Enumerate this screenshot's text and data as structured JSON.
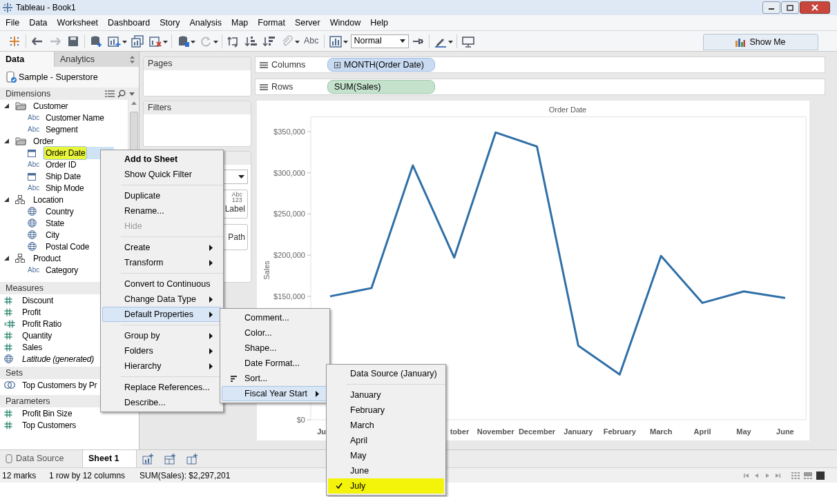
{
  "window": {
    "title": "Tableau - Book1"
  },
  "menu_bar": [
    "File",
    "Data",
    "Worksheet",
    "Dashboard",
    "Story",
    "Analysis",
    "Map",
    "Format",
    "Server",
    "Window",
    "Help"
  ],
  "toolbar": {
    "text_button": "Abc",
    "fit_select": "Normal",
    "show_me": "Show Me"
  },
  "data_pane": {
    "tabs": [
      {
        "label": "Data",
        "selected": true
      },
      {
        "label": "Analytics",
        "selected": false
      }
    ],
    "data_source": "Sample - Superstore",
    "dimensions": {
      "header": "Dimensions",
      "items": [
        {
          "kind": "folder",
          "label": "Customer",
          "expanded": true,
          "selected": false,
          "highlighted": false,
          "children": [
            {
              "kind": "string",
              "type_label": "Abc",
              "label": "Customer Name",
              "selected": false,
              "highlighted": false
            },
            {
              "kind": "string",
              "type_label": "Abc",
              "label": "Segment",
              "selected": false,
              "highlighted": false
            }
          ]
        },
        {
          "kind": "folder",
          "label": "Order",
          "expanded": true,
          "selected": false,
          "highlighted": false,
          "children": [
            {
              "kind": "date",
              "label": "Order Date",
              "selected": true,
              "highlighted": true
            },
            {
              "kind": "string",
              "type_label": "Abc",
              "label": "Order ID",
              "selected": false,
              "highlighted": false
            },
            {
              "kind": "date",
              "label": "Ship Date",
              "selected": false,
              "highlighted": false
            },
            {
              "kind": "string",
              "type_label": "Abc",
              "label": "Ship Mode",
              "selected": false,
              "highlighted": false
            }
          ]
        },
        {
          "kind": "hierarchy",
          "label": "Location",
          "expanded": true,
          "selected": false,
          "highlighted": false,
          "children": [
            {
              "kind": "geo",
              "label": "Country",
              "selected": false,
              "highlighted": false
            },
            {
              "kind": "geo",
              "label": "State",
              "selected": false,
              "highlighted": false
            },
            {
              "kind": "geo",
              "label": "City",
              "selected": false,
              "highlighted": false
            },
            {
              "kind": "geo",
              "label": "Postal Code",
              "selected": false,
              "highlighted": false
            }
          ]
        },
        {
          "kind": "hierarchy",
          "label": "Product",
          "expanded": true,
          "selected": false,
          "highlighted": false,
          "children": [
            {
              "kind": "string",
              "type_label": "Abc",
              "label": "Category",
              "selected": false,
              "highlighted": false
            }
          ]
        }
      ]
    },
    "measures": {
      "header": "Measures",
      "items": [
        {
          "kind": "number",
          "label": "Discount",
          "italic": false
        },
        {
          "kind": "number",
          "label": "Profit",
          "italic": false
        },
        {
          "kind": "calc_number",
          "label": "Profit Ratio",
          "italic": false
        },
        {
          "kind": "number",
          "label": "Quantity",
          "italic": false
        },
        {
          "kind": "number",
          "label": "Sales",
          "italic": false
        },
        {
          "kind": "geo",
          "label": "Latitude (generated)",
          "italic": true
        }
      ]
    },
    "sets": {
      "header": "Sets",
      "items": [
        {
          "kind": "set",
          "label": "Top Customers by Pr",
          "italic": false
        }
      ]
    },
    "parameters": {
      "header": "Parameters",
      "items": [
        {
          "kind": "number",
          "label": "Profit Bin Size",
          "italic": false
        },
        {
          "kind": "number",
          "label": "Top Customers",
          "italic": false
        }
      ]
    }
  },
  "cards": {
    "pages": "Pages",
    "filters": "Filters",
    "marks": {
      "buttons": [
        {
          "kind": "label",
          "icon_lines": [
            "Abc",
            "123"
          ],
          "label": "Label"
        },
        {
          "kind": "path",
          "label": "Path"
        }
      ]
    }
  },
  "shelves": [
    {
      "label": "Columns",
      "pill": {
        "text": "MONTH(Order Date)",
        "kind": "discrete"
      }
    },
    {
      "label": "Rows",
      "pill": {
        "text": "SUM(Sales)",
        "kind": "continuous"
      }
    }
  ],
  "chart_data": {
    "type": "line",
    "title": "Order Date",
    "ylabel": "Sales",
    "categories": [
      "Ju",
      null,
      null,
      "tober",
      "November",
      "December",
      "January",
      "February",
      "March",
      "April",
      "May",
      "June"
    ],
    "series": [
      {
        "color": "#2f6fa7",
        "values": [
          150000,
          160000,
          309000,
          197000,
          349000,
          332000,
          90000,
          55000,
          199000,
          142000,
          156000,
          148000
        ]
      }
    ],
    "ylim": [
      0,
      368000
    ],
    "yticks": [
      {
        "value": 0,
        "label": "$0"
      },
      {
        "value": 150000,
        "label": "$150,000"
      },
      {
        "value": 200000,
        "label": "$200,000"
      },
      {
        "value": 250000,
        "label": "$250,000"
      },
      {
        "value": 300000,
        "label": "$300,000"
      },
      {
        "value": 350000,
        "label": "$350,000"
      }
    ]
  },
  "context_menu": [
    [
      {
        "label": "Add to Sheet",
        "default": true,
        "disabled": false,
        "submenu": false,
        "selected": false
      },
      {
        "label": "Show Quick Filter",
        "default": false,
        "disabled": false,
        "submenu": false,
        "selected": false
      }
    ],
    [
      {
        "label": "Duplicate",
        "default": false,
        "disabled": false,
        "submenu": false,
        "selected": false
      },
      {
        "label": "Rename...",
        "default": false,
        "disabled": false,
        "submenu": false,
        "selected": false
      },
      {
        "label": "Hide",
        "default": false,
        "disabled": true,
        "submenu": false,
        "selected": false
      }
    ],
    [
      {
        "label": "Create",
        "default": false,
        "disabled": false,
        "submenu": true,
        "selected": false
      },
      {
        "label": "Transform",
        "default": false,
        "disabled": false,
        "submenu": true,
        "selected": false
      }
    ],
    [
      {
        "label": "Convert to Continuous",
        "default": false,
        "disabled": false,
        "submenu": false,
        "selected": false
      },
      {
        "label": "Change Data Type",
        "default": false,
        "disabled": false,
        "submenu": true,
        "selected": false
      },
      {
        "label": "Default Properties",
        "default": false,
        "disabled": false,
        "submenu": true,
        "selected": true
      }
    ],
    [
      {
        "label": "Group by",
        "default": false,
        "disabled": false,
        "submenu": true,
        "selected": false
      },
      {
        "label": "Folders",
        "default": false,
        "disabled": false,
        "submenu": true,
        "selected": false
      },
      {
        "label": "Hierarchy",
        "default": false,
        "disabled": false,
        "submenu": true,
        "selected": false
      }
    ],
    [
      {
        "label": "Replace References...",
        "default": false,
        "disabled": false,
        "submenu": false,
        "selected": false
      },
      {
        "label": "Describe...",
        "default": false,
        "disabled": false,
        "submenu": false,
        "selected": false
      }
    ]
  ],
  "properties_menu": [
    {
      "label": "Comment...",
      "kind": "plain",
      "submenu": false,
      "selected": false
    },
    {
      "label": "Color...",
      "kind": "plain",
      "submenu": false,
      "selected": false
    },
    {
      "label": "Shape...",
      "kind": "plain",
      "submenu": false,
      "selected": false
    },
    {
      "label": "Date Format...",
      "kind": "plain",
      "submenu": false,
      "selected": false
    },
    {
      "label": "Sort...",
      "kind": "sort",
      "submenu": false,
      "selected": false
    },
    {
      "label": "Fiscal Year Start",
      "kind": "plain",
      "submenu": true,
      "selected": true
    }
  ],
  "fiscal_menu": [
    [
      {
        "label": "Data Source (January)",
        "checked": false,
        "highlighted": false
      }
    ],
    [
      {
        "label": "January",
        "checked": false,
        "highlighted": false
      },
      {
        "label": "February",
        "checked": false,
        "highlighted": false
      },
      {
        "label": "March",
        "checked": false,
        "highlighted": false
      },
      {
        "label": "April",
        "checked": false,
        "highlighted": false
      },
      {
        "label": "May",
        "checked": false,
        "highlighted": false
      },
      {
        "label": "June",
        "checked": false,
        "highlighted": false
      },
      {
        "label": "July",
        "checked": true,
        "highlighted": true
      }
    ]
  ],
  "sheet_tabs": [
    {
      "label": "Data Source",
      "kind": "data_source",
      "selected": false
    },
    {
      "label": "Sheet 1",
      "kind": "sheet",
      "selected": true
    }
  ],
  "status_bar": [
    "12 marks",
    "1 row by 12 columns",
    "SUM(Sales): $2,297,201"
  ]
}
